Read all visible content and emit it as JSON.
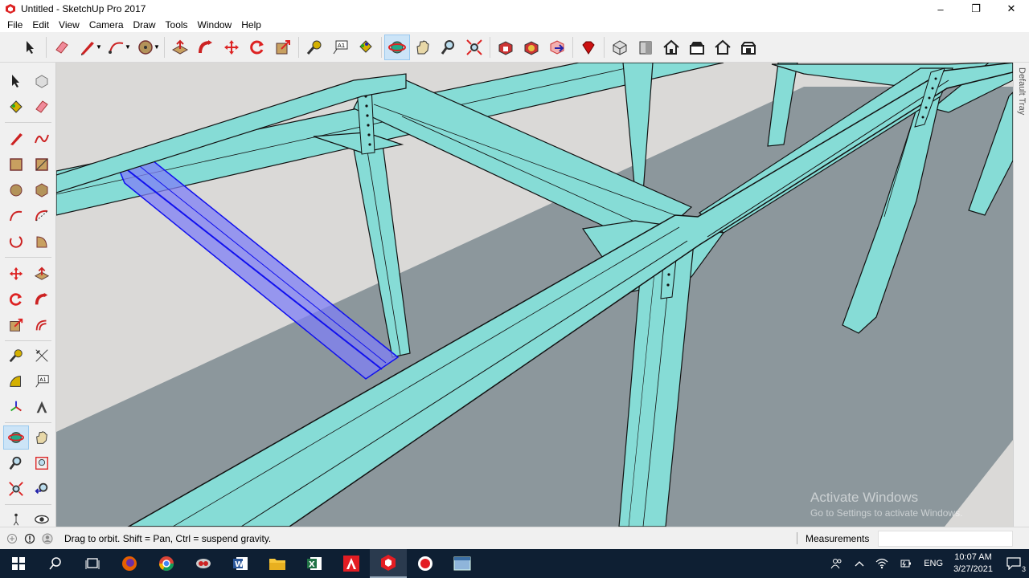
{
  "window": {
    "title": "Untitled - SketchUp Pro 2017"
  },
  "menu": [
    "File",
    "Edit",
    "View",
    "Camera",
    "Draw",
    "Tools",
    "Window",
    "Help"
  ],
  "toolbar": {
    "tools": [
      "select-arrow-icon",
      "eraser-icon",
      "pencil-icon",
      "arc-icon",
      "circle-icon",
      "push-pull-icon",
      "follow-me-icon",
      "move-icon",
      "rotate-icon",
      "scale-icon",
      "tape-measure-icon",
      "text-icon",
      "paint-bucket-icon",
      "orbit-icon",
      "pan-icon",
      "zoom-icon",
      "zoom-extents-icon",
      "warehouse-icon",
      "extension-warehouse-icon",
      "share-model-icon",
      "ruby-icon",
      "iso-view-icon",
      "front-view-icon",
      "top-view-icon",
      "right-view-icon",
      "back-view-icon",
      "left-view-icon"
    ],
    "active_tool": "orbit-icon"
  },
  "right_tray": {
    "label": "Default Tray"
  },
  "status": {
    "hint": "Drag to orbit. Shift = Pan, Ctrl = suspend gravity.",
    "measurements_label": "Measurements",
    "measurements_value": ""
  },
  "watermark": {
    "line1": "Activate Windows",
    "line2": "Go to Settings to activate Windows."
  },
  "taskbar": {
    "apps": [
      "start-icon",
      "search-icon",
      "task-view-icon",
      "firefox-icon",
      "chrome-icon",
      "snipping-icon",
      "word-icon",
      "file-explorer-icon",
      "excel-icon",
      "autocad-icon",
      "sketchup-icon",
      "record-icon",
      "photo-icon"
    ],
    "language": "ENG",
    "time": "10:07 AM",
    "date": "3/27/2021",
    "notifications": "3"
  },
  "colors": {
    "beam": "#86dcd6",
    "beam_side": "#74cdc7",
    "selected": "#7f7ff5",
    "ground": "#8c979c",
    "sky": "#dad9d7"
  }
}
